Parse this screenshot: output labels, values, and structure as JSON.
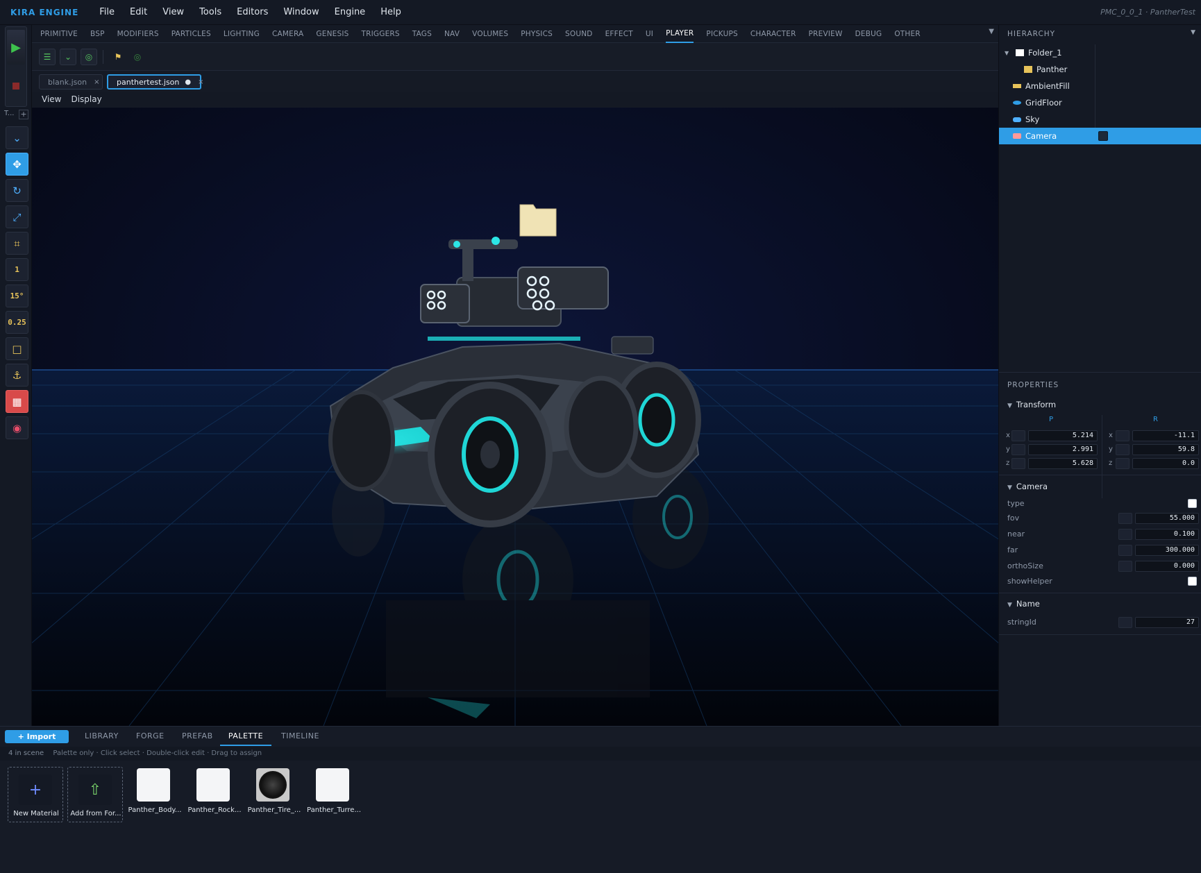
{
  "app": {
    "brand": "KIRA ENGINE",
    "window_title": "PMC_0_0_1 · PantherTest"
  },
  "menu": [
    "File",
    "Edit",
    "View",
    "Tools",
    "Editors",
    "Window",
    "Engine",
    "Help"
  ],
  "categories": {
    "items": [
      "PRIMITIVE",
      "BSP",
      "MODIFIERS",
      "PARTICLES",
      "LIGHTING",
      "CAMERA",
      "GENESIS",
      "TRIGGERS",
      "TAGS",
      "NAV",
      "VOLUMES",
      "PHYSICS",
      "SOUND",
      "EFFECT",
      "UI",
      "PLAYER",
      "PICKUPS",
      "CHARACTER",
      "PREVIEW",
      "DEBUG",
      "OTHER"
    ],
    "active": "PLAYER"
  },
  "left_tools": {
    "t_label": "T...",
    "add": "+",
    "snap_value": "1",
    "angle_snap": "15°",
    "scale_snap": "0.25"
  },
  "file_tabs": [
    {
      "label": "blank.json",
      "close": "×"
    },
    {
      "label": "panthertest.json",
      "modified": "●",
      "close": "×"
    }
  ],
  "view_menu": {
    "view": "View",
    "display": "Display"
  },
  "hierarchy": {
    "title": "HIERARCHY",
    "items": [
      {
        "label": "Folder_1",
        "icon": "folder-icon",
        "color": "#ffffff"
      },
      {
        "label": "Panther",
        "icon": "cube-icon",
        "color": "#e7c35a"
      },
      {
        "label": "AmbientFill",
        "icon": "light-icon",
        "color": "#e7c35a"
      },
      {
        "label": "GridFloor",
        "icon": "grid-icon",
        "color": "#2f9de6"
      },
      {
        "label": "Sky",
        "icon": "sky-icon",
        "color": "#4fb0ff"
      },
      {
        "label": "Camera",
        "icon": "camera-icon",
        "color": "#ff6b6b",
        "selected": true
      }
    ]
  },
  "properties": {
    "title": "PROPERTIES",
    "transform": {
      "title": "Transform",
      "p_label": "P",
      "r_label": "R",
      "axes": [
        "x",
        "y",
        "z"
      ],
      "p": [
        "5.214",
        "2.991",
        "5.628"
      ],
      "r": [
        "-11.1",
        "59.8",
        "0.0"
      ]
    },
    "camera": {
      "title": "Camera",
      "type_label": "type",
      "fov_label": "fov",
      "fov": "55.000",
      "near_label": "near",
      "near": "0.100",
      "far_label": "far",
      "far": "300.000",
      "ortho_label": "orthoSize",
      "ortho": "0.000",
      "helper_label": "showHelper"
    },
    "name": {
      "title": "Name",
      "string_label": "stringId",
      "string_value": "27"
    }
  },
  "bottom": {
    "import_label": "+ Import",
    "tabs": [
      "LIBRARY",
      "FORGE",
      "PREFAB",
      "PALETTE",
      "TIMELINE"
    ],
    "active_tab": "PALETTE",
    "count": "4 in scene",
    "hint": "Palette only · Click select · Double-click edit · Drag to assign",
    "materials": [
      {
        "label": "New Material",
        "icon": "plus-icon"
      },
      {
        "label": "Add from For...",
        "icon": "upload-arrow-icon"
      },
      {
        "label": "Panther_Body..."
      },
      {
        "label": "Panther_Rock..."
      },
      {
        "label": "Panther_Tire_..."
      },
      {
        "label": "Panther_Turre..."
      }
    ]
  },
  "colors": {
    "accent": "#2f9de6",
    "play": "#3ec24d",
    "background": "#161b26",
    "viewport": "#070b1a",
    "glow": "#1fd6d6"
  }
}
